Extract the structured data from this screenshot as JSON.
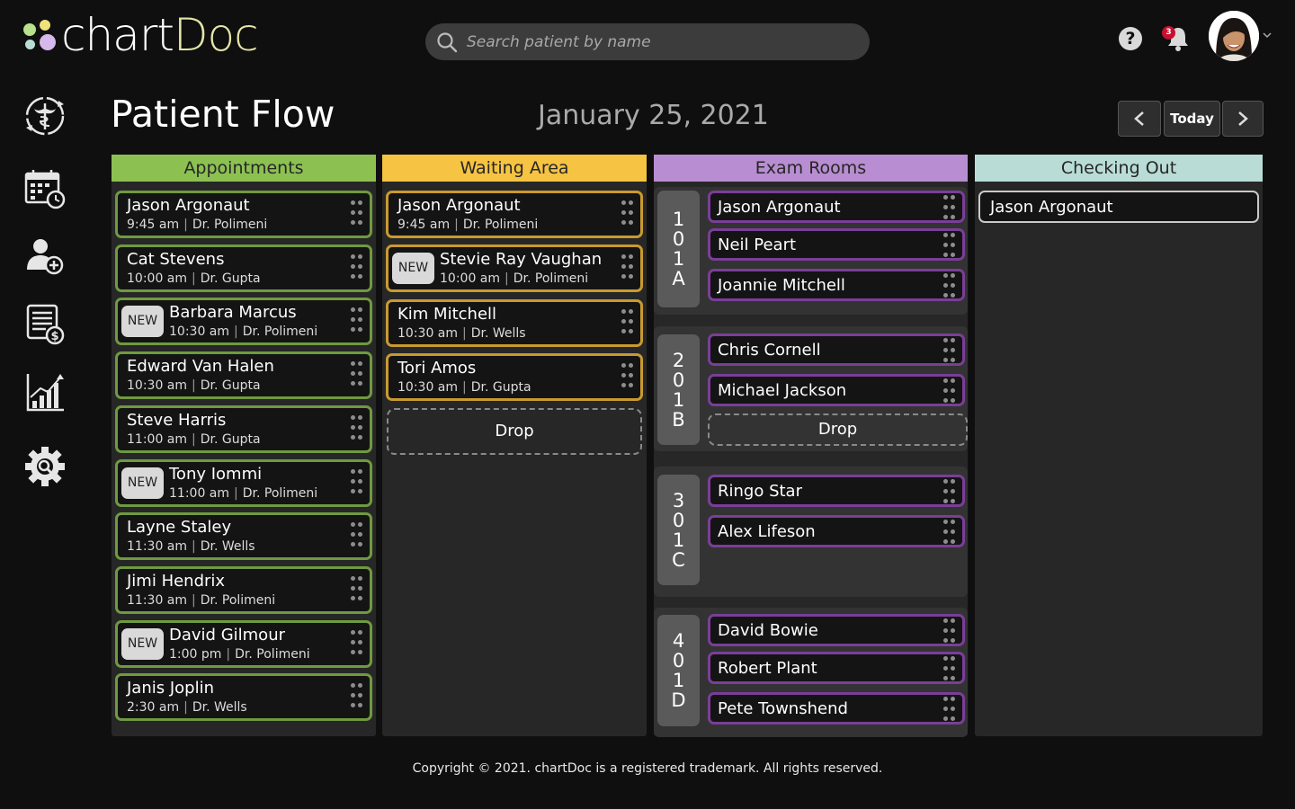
{
  "app": {
    "logo_text": "chartDoc",
    "logo_colors": [
      "#8cc152",
      "#f6c342",
      "#b88dd1",
      "#b9ddd6"
    ]
  },
  "search": {
    "placeholder": "Search patient by name",
    "icon": "search-icon"
  },
  "header": {
    "help_icon": "question-circle-icon",
    "notifications_count": "3",
    "bell_icon": "bell-icon",
    "avatar": "user-avatar"
  },
  "sidebar": {
    "items": [
      {
        "icon": "patient-flow-icon"
      },
      {
        "icon": "calendar-clock-icon"
      },
      {
        "icon": "add-user-icon"
      },
      {
        "icon": "billing-icon"
      },
      {
        "icon": "reports-chart-icon"
      },
      {
        "icon": "settings-gear-icon"
      }
    ]
  },
  "page": {
    "title": "Patient Flow",
    "date": "January 25, 2021",
    "today_label": "Today",
    "prev_icon": "chevron-left-icon",
    "next_icon": "chevron-right-icon"
  },
  "columns": {
    "appointments": {
      "title": "Appointments",
      "items": [
        {
          "name": "Jason Argonaut",
          "time": "9:45 am",
          "doctor": "Dr. Polimeni",
          "new": false
        },
        {
          "name": "Cat Stevens",
          "time": "10:00 am",
          "doctor": "Dr. Gupta",
          "new": false
        },
        {
          "name": "Barbara Marcus",
          "time": "10:30 am",
          "doctor": "Dr. Polimeni",
          "new": true
        },
        {
          "name": "Edward Van Halen",
          "time": "10:30 am",
          "doctor": "Dr. Gupta",
          "new": false
        },
        {
          "name": "Steve Harris",
          "time": "11:00 am",
          "doctor": "Dr. Gupta",
          "new": false
        },
        {
          "name": "Tony Iommi",
          "time": "11:00 am",
          "doctor": "Dr. Polimeni",
          "new": true
        },
        {
          "name": "Layne Staley",
          "time": "11:30 am",
          "doctor": "Dr. Wells",
          "new": false
        },
        {
          "name": "Jimi Hendrix",
          "time": "11:30 am",
          "doctor": "Dr. Polimeni",
          "new": false
        },
        {
          "name": "David Gilmour",
          "time": "1:00 pm",
          "doctor": "Dr. Polimeni",
          "new": true
        },
        {
          "name": "Janis Joplin",
          "time": "2:30 am",
          "doctor": "Dr. Wells",
          "new": false
        }
      ]
    },
    "waiting": {
      "title": "Waiting Area",
      "items": [
        {
          "name": "Jason Argonaut",
          "time": "9:45 am",
          "doctor": "Dr. Polimeni",
          "new": false
        },
        {
          "name": "Stevie Ray Vaughan",
          "time": "10:00 am",
          "doctor": "Dr. Polimeni",
          "new": true
        },
        {
          "name": "Kim Mitchell",
          "time": "10:30 am",
          "doctor": "Dr. Wells",
          "new": false
        },
        {
          "name": "Tori Amos",
          "time": "10:30 am",
          "doctor": "Dr. Gupta",
          "new": false
        }
      ],
      "drop_label": "Drop"
    },
    "exam": {
      "title": "Exam Rooms",
      "rooms": [
        {
          "label": [
            "1",
            "0",
            "1",
            "A"
          ],
          "patients": [
            "Jason Argonaut",
            "Neil Peart",
            "Joannie Mitchell"
          ]
        },
        {
          "label": [
            "2",
            "0",
            "1",
            "B"
          ],
          "patients": [
            "Chris Cornell",
            "Michael Jackson"
          ],
          "drop_label": "Drop"
        },
        {
          "label": [
            "3",
            "0",
            "1",
            "C"
          ],
          "patients": [
            "Ringo Star",
            "Alex Lifeson"
          ]
        },
        {
          "label": [
            "4",
            "0",
            "1",
            "D"
          ],
          "patients": [
            "David Bowie",
            "Robert Plant",
            "Pete Townshend"
          ]
        }
      ]
    },
    "checkout": {
      "title": "Checking Out",
      "items": [
        "Jason Argonaut"
      ]
    }
  },
  "new_badge_label": "NEW",
  "footer": "Copyright © 2021. chartDoc is a registered trademark. All rights reserved."
}
